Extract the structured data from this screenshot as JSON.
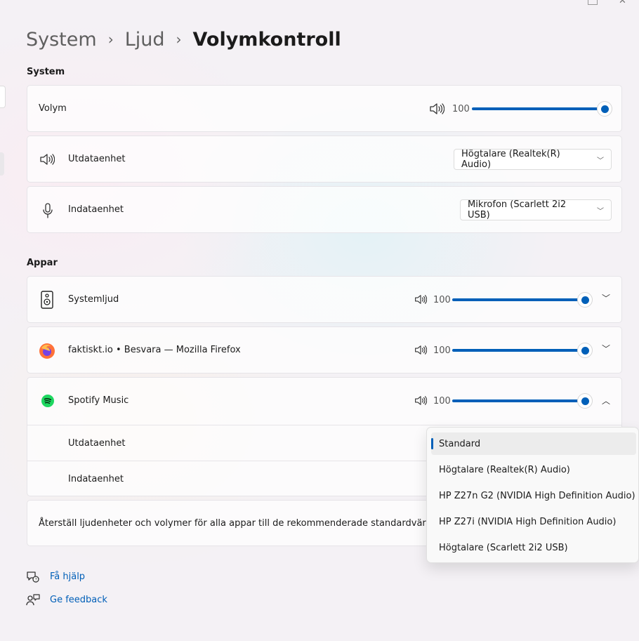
{
  "breadcrumb": {
    "item1": "System",
    "item2": "Ljud",
    "current": "Volymkontroll"
  },
  "system_section": {
    "title": "System",
    "volume": {
      "label": "Volym",
      "value": "100",
      "level": 1.0,
      "icon": "speaker-icon"
    },
    "output": {
      "label": "Utdataenhet",
      "selected": "Högtalare (Realtek(R) Audio)",
      "icon": "speaker-icon"
    },
    "input": {
      "label": "Indataenhet",
      "selected": "Mikrofon (Scarlett 2i2 USB)",
      "icon": "microphone-icon"
    }
  },
  "apps_section": {
    "title": "Appar",
    "apps": [
      {
        "name": "Systemljud",
        "value": "100",
        "level": 1.0,
        "icon": "system-sounds-icon"
      },
      {
        "name": "faktiskt.io • Besvara — Mozilla Firefox",
        "value": "100",
        "level": 1.0,
        "icon": "firefox-icon"
      },
      {
        "name": "Spotify Music",
        "value": "100",
        "level": 1.0,
        "icon": "spotify-icon",
        "expanded": {
          "output_label": "Utdataenhet",
          "input_label": "Indataenhet"
        }
      }
    ],
    "reset_text": "Återställ ljudenheter och volymer för alla appar till de rekommenderade standardvärdena"
  },
  "output_dropdown": {
    "selected_index": 0,
    "options": [
      "Standard",
      "Högtalare (Realtek(R) Audio)",
      "HP Z27n G2 (NVIDIA High Definition Audio)",
      "HP Z27i (NVIDIA High Definition Audio)",
      "Högtalare (Scarlett 2i2 USB)"
    ]
  },
  "links": {
    "help": "Få hjälp",
    "feedback": "Ge feedback"
  },
  "colors": {
    "accent": "#005fb8",
    "spotify": "#1ed760",
    "firefox": "#ff7139"
  }
}
